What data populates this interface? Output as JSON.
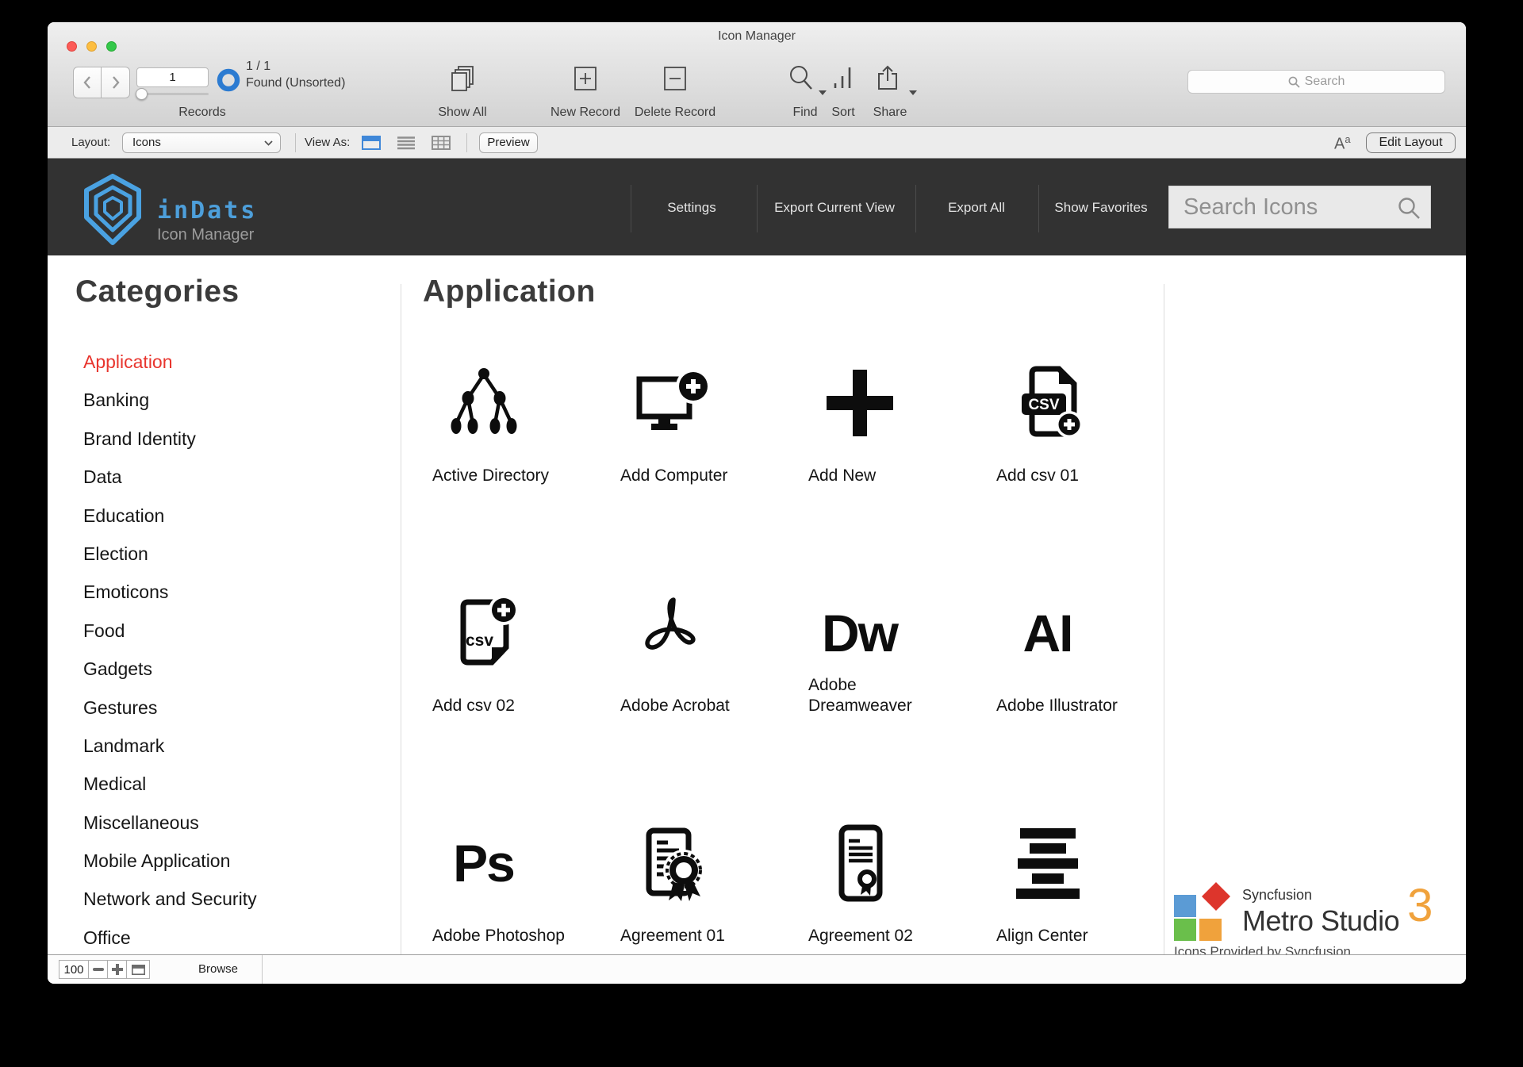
{
  "window": {
    "title": "Icon Manager"
  },
  "toolbar": {
    "record_value": "1",
    "found_count": "1 / 1",
    "found_label": "Found (Unsorted)",
    "records_label": "Records",
    "show_all": "Show All",
    "new_record": "New Record",
    "delete_record": "Delete Record",
    "find": "Find",
    "sort": "Sort",
    "share": "Share",
    "search_placeholder": "Search"
  },
  "layout_bar": {
    "layout_label": "Layout:",
    "layout_value": "Icons",
    "view_as_label": "View As:",
    "preview": "Preview",
    "format_toggle": "Aa",
    "edit_layout": "Edit Layout"
  },
  "header": {
    "brand": "inDats",
    "brand_sub": "Icon Manager",
    "menu": [
      "Settings",
      "Export Current View",
      "Export All",
      "Show Favorites"
    ],
    "search_placeholder": "Search Icons"
  },
  "sidebar": {
    "title": "Categories",
    "selected": "Application",
    "items": [
      "Application",
      "Banking",
      "Brand Identity",
      "Data",
      "Education",
      "Election",
      "Emoticons",
      "Food",
      "Gadgets",
      "Gestures",
      "Landmark",
      "Medical",
      "Miscellaneous",
      "Mobile Application",
      "Network and Security",
      "Office"
    ]
  },
  "main": {
    "title": "Application",
    "icons": [
      {
        "label": "Active Directory",
        "glyph": "active-directory-icon"
      },
      {
        "label": "Add Computer",
        "glyph": "add-computer-icon"
      },
      {
        "label": "Add New",
        "glyph": "add-new-icon"
      },
      {
        "label": "Add csv 01",
        "glyph": "add-csv-01-icon"
      },
      {
        "label": "Add csv 02",
        "glyph": "add-csv-02-icon"
      },
      {
        "label": "Adobe Acrobat",
        "glyph": "adobe-acrobat-icon"
      },
      {
        "label": "Adobe Dreamweaver",
        "glyph": "adobe-dreamweaver-icon",
        "text": "Dw"
      },
      {
        "label": "Adobe Illustrator",
        "glyph": "adobe-illustrator-icon",
        "text": "AI"
      },
      {
        "label": "Adobe Photoshop",
        "glyph": "adobe-photoshop-icon",
        "text": "Ps"
      },
      {
        "label": "Agreement 01",
        "glyph": "agreement-01-icon"
      },
      {
        "label": "Agreement 02",
        "glyph": "agreement-02-icon"
      },
      {
        "label": "Align Center",
        "glyph": "align-center-icon"
      }
    ]
  },
  "footer_logo": {
    "brand_top": "Syncfusion",
    "brand_main": "Metro Studio",
    "brand_version": "3",
    "caption": "Icons Provided by Syncfusion",
    "colors": {
      "blue": "#5b9bd5",
      "red": "#dd352c",
      "green": "#6abf4b",
      "orange": "#f0a23c"
    }
  },
  "status_bar": {
    "zoom_value": "100",
    "mode": "Browse"
  },
  "colors": {
    "accent_red": "#e8352e",
    "brand_blue": "#4d9fdb",
    "header_bg": "#323232",
    "donut_blue": "#2c7bd1",
    "selected_view_blue": "#3f87d8"
  }
}
